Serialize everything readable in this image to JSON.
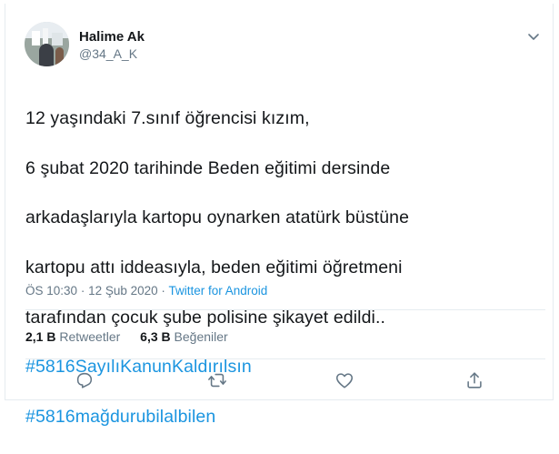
{
  "author": {
    "name": "Halime Ak",
    "handle": "@34_A_K"
  },
  "tweet": {
    "lines": [
      "12 yaşındaki 7.sınıf öğrencisi kızım,",
      "6 şubat 2020 tarihinde Beden eğitimi dersinde",
      "arkadaşlarıyla kartopu oynarken atatürk büstüne",
      "kartopu attı iddeasıyla, beden eğitimi öğretmeni",
      "tarafından çocuk şube polisine şikayet edildi.."
    ],
    "hashtags": [
      "#5816SayılıKanunKaldırılsın",
      "#5816mağdurubilalbilen"
    ]
  },
  "meta": {
    "time": "ÖS 10:30",
    "separator": "·",
    "date": "12 Şub 2020",
    "source": "Twitter for Android"
  },
  "stats": {
    "retweets_count": "2,1 B",
    "retweets_label": "Retweetler",
    "likes_count": "6,3 B",
    "likes_label": "Beğeniler"
  },
  "icons": {
    "reply": "reply-icon",
    "retweet": "retweet-icon",
    "like": "like-icon",
    "share": "share-icon",
    "more": "chevron-down-icon"
  },
  "colors": {
    "link": "#1b95e0",
    "text": "#14171a",
    "muted": "#657786",
    "border": "#e6ecf0"
  }
}
